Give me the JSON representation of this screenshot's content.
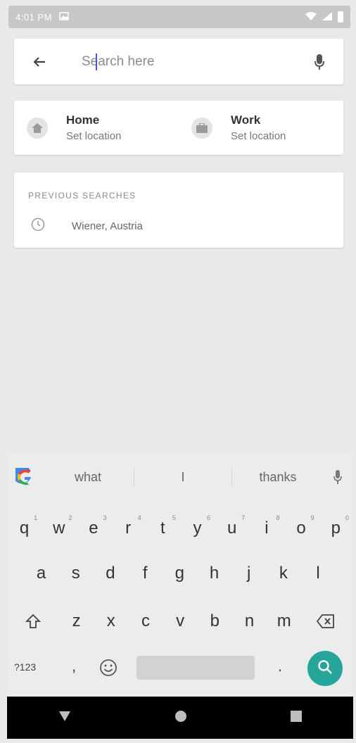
{
  "status_bar": {
    "time": "4:01 PM",
    "colors": {
      "bg": "#c7c7c7"
    }
  },
  "search": {
    "placeholder": "Search here"
  },
  "shortcuts": [
    {
      "title": "Home",
      "subtitle": "Set location",
      "icon": "home-icon"
    },
    {
      "title": "Work",
      "subtitle": "Set location",
      "icon": "briefcase-icon"
    }
  ],
  "previous_searches": {
    "heading": "PREVIOUS SEARCHES",
    "items": [
      {
        "text": "Wiener, Austria",
        "icon": "history-clock-icon"
      }
    ]
  },
  "keyboard": {
    "suggestions": [
      "what",
      "I",
      "thanks"
    ],
    "row1": [
      "q",
      "w",
      "e",
      "r",
      "t",
      "y",
      "u",
      "i",
      "o",
      "p"
    ],
    "row1_hints": [
      "1",
      "2",
      "3",
      "4",
      "5",
      "6",
      "7",
      "8",
      "9",
      "0"
    ],
    "row2": [
      "a",
      "s",
      "d",
      "f",
      "g",
      "h",
      "j",
      "k",
      "l"
    ],
    "row3": [
      "z",
      "x",
      "c",
      "v",
      "b",
      "n",
      "m"
    ],
    "symbols_key": "?123",
    "comma_key": ",",
    "period_key": ".",
    "accent": "#26a69a"
  }
}
